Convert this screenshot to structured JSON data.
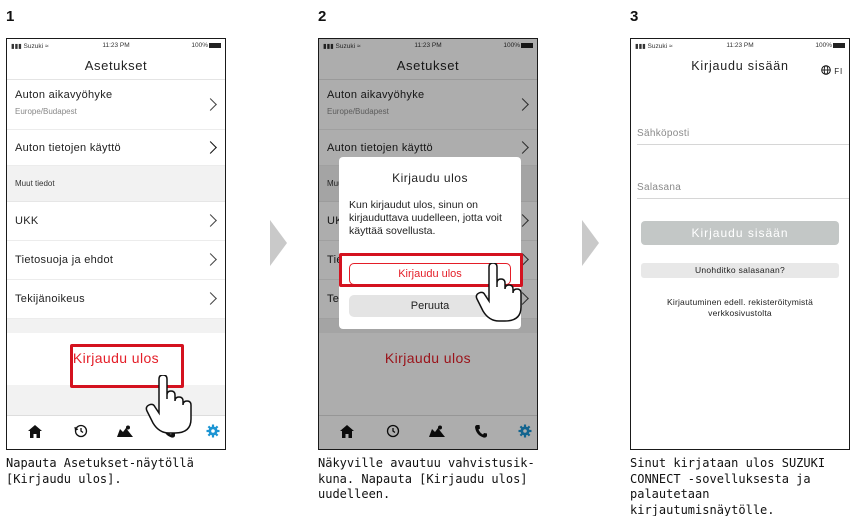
{
  "steps": [
    "1",
    "2",
    "3"
  ],
  "status": {
    "carrier": "Suzuki",
    "time1": "11:23 PM",
    "time2": "11:23 PM",
    "time3": "11:23 PM",
    "battery": "100%"
  },
  "settings": {
    "title": "Asetukset",
    "timezone_label": "Auton aikavyöhyke",
    "timezone_value": "Europe/Budapest",
    "car_data_label": "Auton tietojen käyttö",
    "section_label": "Muut tiedot",
    "faq_label": "UKK",
    "privacy_label": "Tietosuoja ja ehdot",
    "copyright_label": "Tekijänoikeus",
    "logout_label": "Kirjaudu ulos"
  },
  "dialog": {
    "title": "Kirjaudu ulos",
    "message": "Kun kirjaudut ulos, sinun on kirjauduttava uudelleen, jotta voit käyttää sovellusta.",
    "confirm_label": "Kirjaudu ulos",
    "cancel_label": "Peruuta"
  },
  "login": {
    "title": "Kirjaudu sisään",
    "language": "FI",
    "email_placeholder": "Sähköposti",
    "password_placeholder": "Salasana",
    "login_button": "Kirjaudu sisään",
    "forgot_button": "Unohditko salasanan?",
    "register_text": "Kirjautuminen edell. rekisteröitymistä verkkosivustolta"
  },
  "tabs": [
    "home-icon",
    "history-icon",
    "map-icon",
    "phone-icon",
    "gear-icon"
  ],
  "captions": [
    "Napauta Asetukset-näytöllä [Kirjaudu ulos].",
    "Näkyville avautuu vahvistusik-kuna. Napauta [Kirjaudu ulos] uudelleen.",
    "Sinut kirjataan ulos SUZUKI CONNECT -sovelluksesta ja palautetaan kirjautumisnäytölle."
  ],
  "colors": {
    "accent_red": "#e41e28",
    "active_tab": "#1b94d3",
    "highlight": "#d4121f",
    "arrow": "#c9c9c9"
  }
}
